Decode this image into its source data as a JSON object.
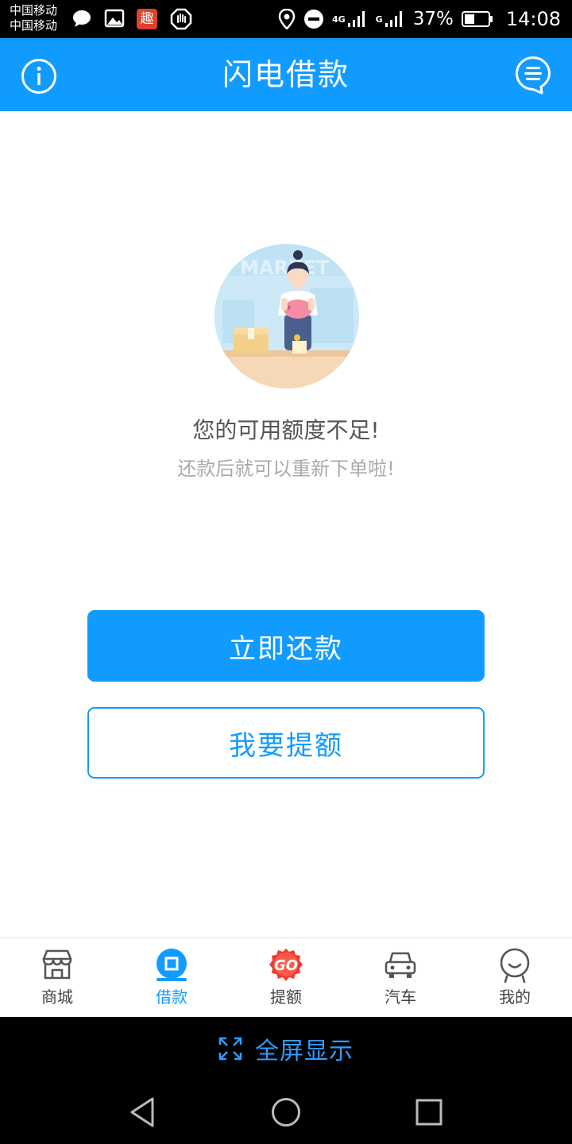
{
  "status_bar": {
    "carrier_1": "中国移动",
    "carrier_2": "中国移动",
    "app_badge": "趣",
    "net_1": "4G",
    "net_2": "G",
    "battery": "37%",
    "time": "14:08"
  },
  "header": {
    "title": "闪电借款",
    "left_icon": "info-icon",
    "right_icon": "message-list-icon"
  },
  "main": {
    "illustration_text": "MARKET",
    "message_title": "您的可用额度不足!",
    "message_subtitle": "还款后就可以重新下单啦!",
    "primary_button": "立即还款",
    "secondary_button": "我要提额"
  },
  "bottom_nav": {
    "items": [
      {
        "label": "商城",
        "icon": "store-icon"
      },
      {
        "label": "借款",
        "icon": "loan-icon",
        "active": true
      },
      {
        "label": "提额",
        "icon": "go-badge-icon",
        "badge_text": "GO"
      },
      {
        "label": "汽车",
        "icon": "car-icon"
      },
      {
        "label": "我的",
        "icon": "profile-icon"
      }
    ]
  },
  "fullscreen": {
    "label": "全屏显示"
  },
  "colors": {
    "brand": "#129bff",
    "badge_red": "#f03a2e"
  }
}
